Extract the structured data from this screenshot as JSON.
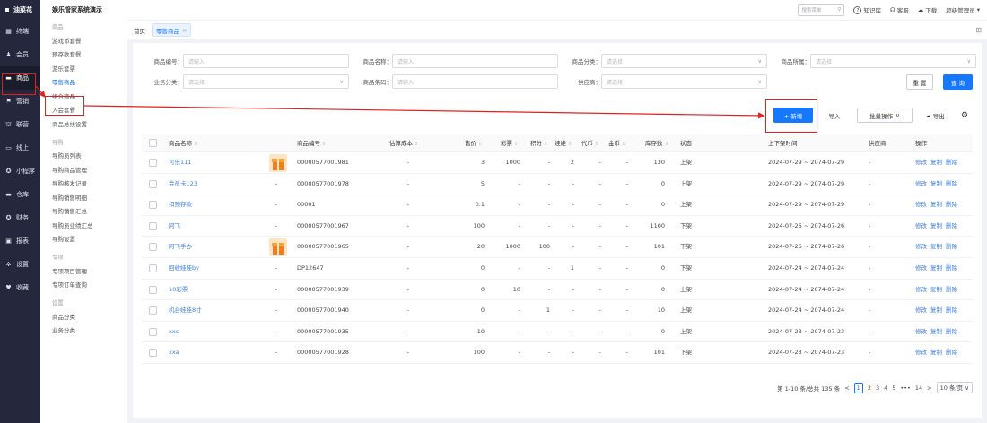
{
  "rail": {
    "logo": "油菜花",
    "items": [
      {
        "icon": "▦",
        "label": "终端"
      },
      {
        "icon": "♟",
        "label": "会员"
      },
      {
        "icon": "▬",
        "label": "商品"
      },
      {
        "icon": "⚑",
        "label": "营销"
      },
      {
        "icon": "⛫",
        "label": "联营"
      },
      {
        "icon": "▭",
        "label": "线上"
      },
      {
        "icon": "✪",
        "label": "小程序"
      },
      {
        "icon": "▬",
        "label": "仓库"
      },
      {
        "icon": "✪",
        "label": "财务"
      },
      {
        "icon": "▣",
        "label": "报表"
      },
      {
        "icon": "✲",
        "label": "设置"
      },
      {
        "icon": "♥",
        "label": "收藏"
      }
    ]
  },
  "side": {
    "title": "娱乐管家系统演示",
    "groups": [
      {
        "label": "商品",
        "items": [
          "游戏币套餐",
          "预存款套餐",
          "游乐套票",
          "零售商品",
          "组合商品",
          "入会套餐",
          "商品总线设置"
        ]
      },
      {
        "label": "导购",
        "items": [
          "导购员列表",
          "导购商品管理",
          "导购核发记录",
          "导购销售明细",
          "导购销售汇总",
          "导购员业绩汇总",
          "导购设置"
        ]
      },
      {
        "label": "专项",
        "items": [
          "专项项目管理",
          "专项订单查询"
        ]
      },
      {
        "label": "设置",
        "items": [
          "商品分类",
          "业务分类"
        ]
      }
    ]
  },
  "top": {
    "search_placeholder": "搜索菜单",
    "help": "知识库",
    "service": "客服",
    "download": "下载",
    "user": "超级管理员"
  },
  "tabs": [
    "首页",
    "零售商品"
  ],
  "filters": {
    "code_label": "商品编号：",
    "code_ph": "请输入",
    "name_label": "商品名称：",
    "name_ph": "请输入",
    "cat_label": "商品分类：",
    "cat_ph": "请选择",
    "belong_label": "商品所属：",
    "belong_ph": "请选择",
    "biz_label": "业务分类：",
    "biz_ph": "请选择",
    "barcode_label": "商品条码：",
    "barcode_ph": "请输入",
    "supplier_label": "供应商：",
    "supplier_ph": "请选择",
    "reset": "重 置",
    "query": "查 询"
  },
  "toolbar": {
    "add": "+ 新增",
    "import": "导入",
    "batch": "批量操作",
    "export": "导出"
  },
  "columns": [
    "商品名称",
    "商品编号",
    "估算成本",
    "售价",
    "彩票",
    "积分",
    "娃娃",
    "代币",
    "金币",
    "库存数",
    "状态",
    "上下架时间",
    "供应商",
    "操作"
  ],
  "ops": [
    "修改",
    "复制",
    "删除"
  ],
  "rows": [
    {
      "name": "可乐111",
      "img": true,
      "code": "00000577001981",
      "cost": "-",
      "price": "3",
      "ticket": "1000",
      "points": "-",
      "doll": "2",
      "token": "-",
      "gold": "-",
      "stock": "130",
      "status": "上架",
      "time": "2024-07-29 ~ 2074-07-29",
      "supplier": "-"
    },
    {
      "name": "会员卡123",
      "img": false,
      "code": "00000577001978",
      "cost": "-",
      "price": "5",
      "ticket": "-",
      "points": "-",
      "doll": "-",
      "token": "-",
      "gold": "-",
      "stock": "0",
      "status": "上架",
      "time": "2024-07-29 ~ 2074-07-29",
      "supplier": "-"
    },
    {
      "name": "扣预存款",
      "img": false,
      "code": "00001",
      "cost": "-",
      "price": "0.1",
      "ticket": "-",
      "points": "-",
      "doll": "-",
      "token": "-",
      "gold": "-",
      "stock": "0",
      "status": "上架",
      "time": "2024-07-29 ~ 2074-07-29",
      "supplier": "-"
    },
    {
      "name": "阿飞",
      "img": false,
      "code": "00000577001967",
      "cost": "-",
      "price": "100",
      "ticket": "-",
      "points": "-",
      "doll": "-",
      "token": "-",
      "gold": "-",
      "stock": "1100",
      "status": "下架",
      "time": "2024-07-26 ~ 2074-07-26",
      "supplier": "-"
    },
    {
      "name": "阿飞手办",
      "img": true,
      "code": "00000577001965",
      "cost": "-",
      "price": "20",
      "ticket": "1000",
      "points": "100",
      "doll": "-",
      "token": "-",
      "gold": "-",
      "stock": "101",
      "status": "下架",
      "time": "2024-07-26 ~ 2074-07-26",
      "supplier": "-"
    },
    {
      "name": "回收娃娃by",
      "img": false,
      "code": "DP12647",
      "cost": "-",
      "price": "0",
      "ticket": "-",
      "points": "-",
      "doll": "1",
      "token": "-",
      "gold": "-",
      "stock": "0",
      "status": "下架",
      "time": "2024-07-24 ~ 2074-07-24",
      "supplier": "-"
    },
    {
      "name": "10彩票",
      "img": false,
      "code": "00000577001939",
      "cost": "-",
      "price": "0",
      "ticket": "10",
      "points": "-",
      "doll": "-",
      "token": "-",
      "gold": "-",
      "stock": "0",
      "status": "上架",
      "time": "2024-07-24 ~ 2074-07-24",
      "supplier": "-"
    },
    {
      "name": "机台娃娃8寸",
      "img": false,
      "code": "00000577001940",
      "cost": "-",
      "price": "0",
      "ticket": "-",
      "points": "1",
      "doll": "-",
      "token": "-",
      "gold": "-",
      "stock": "10",
      "status": "上架",
      "time": "2024-07-24 ~ 2074-07-24",
      "supplier": "-"
    },
    {
      "name": "xxc",
      "img": false,
      "code": "00000577001935",
      "cost": "-",
      "price": "10",
      "ticket": "-",
      "points": "-",
      "doll": "-",
      "token": "-",
      "gold": "-",
      "stock": "0",
      "status": "上架",
      "time": "2024-07-23 ~ 2074-07-23",
      "supplier": "-"
    },
    {
      "name": "xxa",
      "img": false,
      "code": "00000577001928",
      "cost": "-",
      "price": "100",
      "ticket": "-",
      "points": "-",
      "doll": "-",
      "token": "-",
      "gold": "-",
      "stock": "101",
      "status": "下架",
      "time": "2024-07-23 ~ 2074-07-23",
      "supplier": "-"
    }
  ],
  "pager": {
    "summary": "第 1-10 条/总共 135 条",
    "pages": [
      "1",
      "2",
      "3",
      "4",
      "5",
      "•••",
      "14"
    ],
    "size": "10 条/页"
  },
  "colors": {
    "rail_bg": "#25283d",
    "primary": "#1677ff",
    "annotation": "#e02020"
  }
}
